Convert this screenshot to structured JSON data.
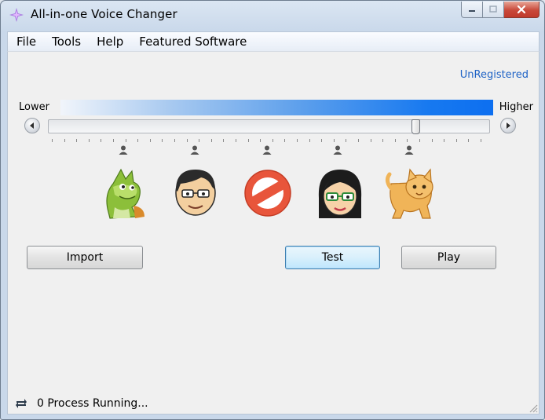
{
  "window": {
    "title": "All-in-one Voice Changer"
  },
  "menu": {
    "items": [
      "File",
      "Tools",
      "Help",
      "Featured Software"
    ]
  },
  "registration": {
    "label": "UnRegistered"
  },
  "pitch": {
    "lower_label": "Lower",
    "higher_label": "Higher",
    "level": 0.84
  },
  "voices": [
    "dragon",
    "man",
    "no-voice",
    "woman",
    "cat"
  ],
  "buttons": {
    "import": "Import",
    "test": "Test",
    "play": "Play"
  },
  "status": {
    "text": "0 Process Running..."
  },
  "colors": {
    "link": "#1f63c6",
    "bar_end": "#0d6ff0",
    "close": "#c9493a"
  }
}
